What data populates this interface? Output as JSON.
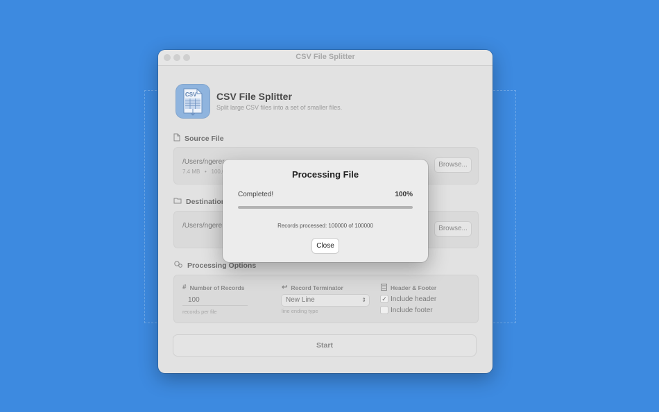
{
  "window": {
    "title": "CSV File Splitter"
  },
  "app": {
    "icon_label": "CSV",
    "name": "CSV File Splitter",
    "subtitle": "Split large CSV files into a set of smaller files."
  },
  "source": {
    "heading": "Source File",
    "path": "/Users/ngerer",
    "meta_size": "7.4 MB",
    "meta_sep": "•",
    "meta_rows": "100,0",
    "browse_label": "Browse..."
  },
  "destination": {
    "heading": "Destination",
    "path": "/Users/ngerer",
    "browse_label": "Browse..."
  },
  "options": {
    "heading": "Processing Options",
    "records_label": "Number of Records",
    "records_value": "100",
    "records_hint": "records per file",
    "terminator_label": "Record Terminator",
    "terminator_value": "New Line",
    "terminator_hint": "line ending type",
    "header_footer_label": "Header & Footer",
    "include_header": "Include header",
    "include_header_checked": true,
    "include_footer": "Include footer",
    "include_footer_checked": false
  },
  "start_label": "Start",
  "modal": {
    "title": "Processing File",
    "status": "Completed!",
    "percent": "100%",
    "progress_fraction": 1.0,
    "records_text": "Records processed: 100000 of 100000",
    "close_label": "Close"
  },
  "icons": [
    "document-icon",
    "folder-icon",
    "gears-icon",
    "hash-icon",
    "return-icon",
    "header-footer-icon",
    "checkmark-icon",
    "updown-chevron-icon"
  ],
  "colors": {
    "desktop": "#3d8ae0",
    "window": "#e2e2e2",
    "modal": "#ececec",
    "app_icon": "#8fb4de"
  }
}
